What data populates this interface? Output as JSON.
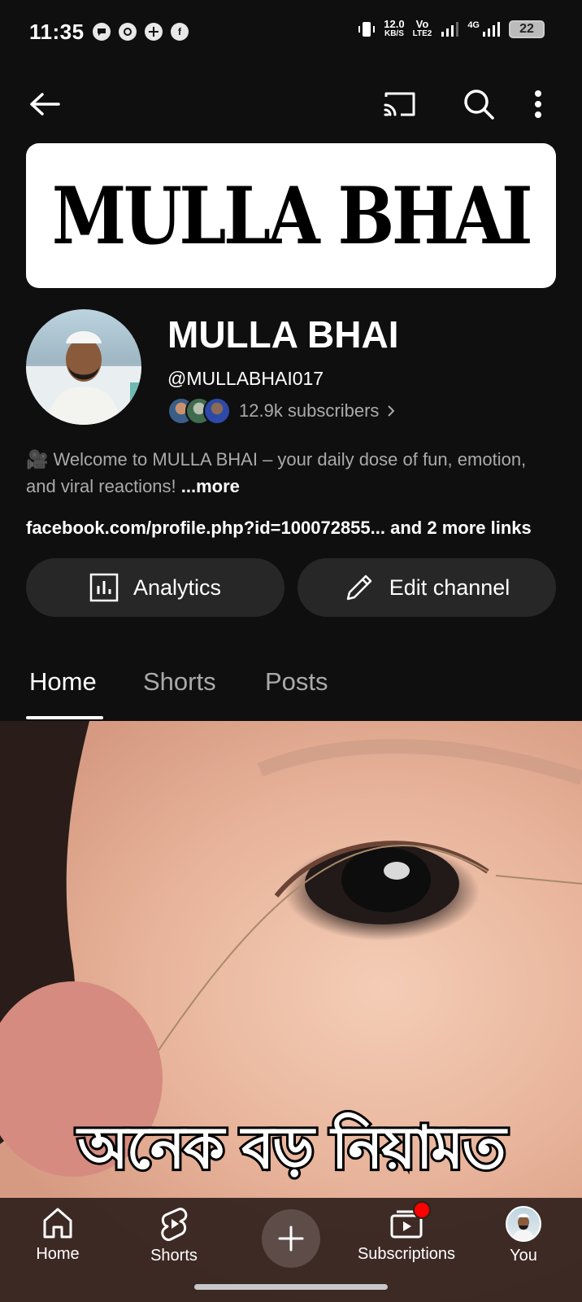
{
  "status_bar": {
    "time": "11:35",
    "net_speed": "12.0",
    "net_unit": "KB/S",
    "volte": "Vo",
    "lte": "LTE2",
    "network": "4G",
    "battery": "22"
  },
  "top_bar": {
    "back_icon": "arrow-left-icon",
    "cast_icon": "cast-icon",
    "search_icon": "search-icon",
    "more_icon": "more-vert-icon"
  },
  "banner": {
    "text": "MULLA BHAI"
  },
  "channel": {
    "name": "MULLA BHAI",
    "handle": "@MULLABHAI017",
    "subscribers": "12.9k subscribers",
    "description": "🎥 Welcome to MULLA BHAI – your daily dose of fun, emotion, and viral reactions!",
    "more_label": "...more",
    "link": "facebook.com/profile.php?id=100072855...",
    "more_links": "and 2 more links"
  },
  "actions": {
    "analytics_label": "Analytics",
    "edit_label": "Edit channel"
  },
  "tabs": [
    {
      "label": "Home",
      "active": true
    },
    {
      "label": "Shorts",
      "active": false
    },
    {
      "label": "Posts",
      "active": false
    }
  ],
  "video": {
    "caption": "অনেক বড় নিয়ামত"
  },
  "bottom_nav": {
    "home": "Home",
    "shorts": "Shorts",
    "subscriptions": "Subscriptions",
    "you": "You"
  },
  "colors": {
    "background": "#0f0f0f",
    "pill": "#272727",
    "notification_dot": "#ff0000"
  }
}
